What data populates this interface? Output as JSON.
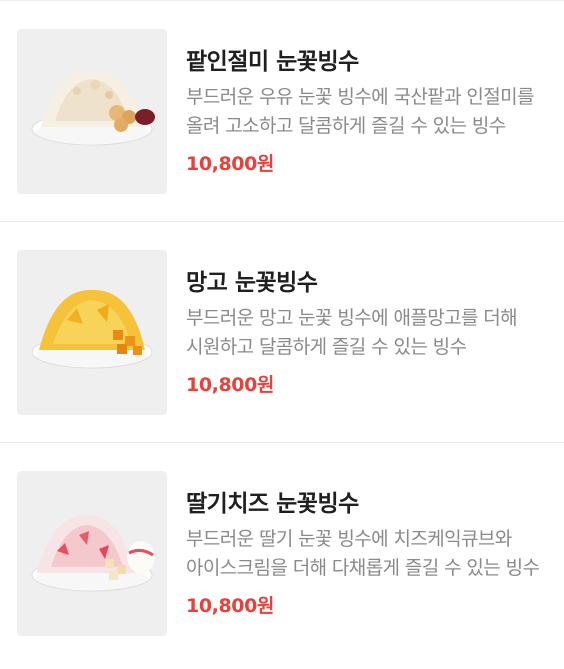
{
  "menu_items": [
    {
      "name": "팥인절미 눈꽃빙수",
      "description": "부드러운 우유 눈꽃 빙수에 국산팥과 인절미를 올려 고소하고 달콤하게 즐길 수 있는 빙수",
      "price": "10,800원",
      "image_icon": "red-bean-injeolmi-bingsu-image",
      "colors": {
        "topping": "#f3e9d9",
        "accent": "#e0a85a",
        "bean": "#7a1f2a"
      }
    },
    {
      "name": "망고 눈꽃빙수",
      "description": "부드러운 망고 눈꽃 빙수에 애플망고를 더해 시원하고 달콤하게 즐길 수 있는 빙수",
      "price": "10,800원",
      "image_icon": "mango-bingsu-image",
      "colors": {
        "topping": "#f6c23a",
        "accent": "#f0a020",
        "bean": "#e88a14"
      }
    },
    {
      "name": "딸기치즈 눈꽃빙수",
      "description": "부드러운 딸기 눈꽃 빙수에 치즈케익큐브와 아이스크림을 더해 다채롭게 즐길 수 있는 빙수",
      "price": "10,800원",
      "image_icon": "strawberry-cheese-bingsu-image",
      "colors": {
        "topping": "#f7d6d9",
        "accent": "#e94f5e",
        "bean": "#f3e3b4"
      }
    }
  ],
  "colors": {
    "price": "#e8413a",
    "title": "#1f1f1f",
    "description": "#8a8a8a",
    "thumbnail_bg": "#efefef"
  }
}
